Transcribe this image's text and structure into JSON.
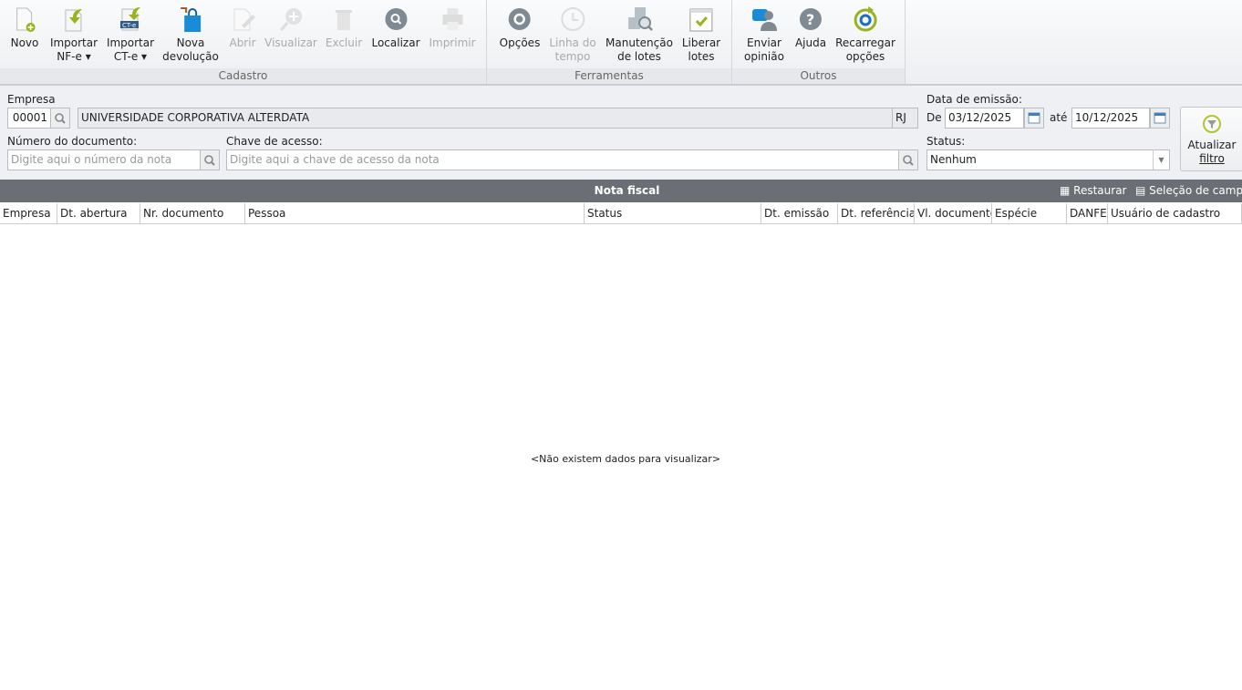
{
  "ribbon": {
    "groups": [
      {
        "label": "Cadastro"
      },
      {
        "label": "Ferramentas"
      },
      {
        "label": "Outros"
      }
    ],
    "buttons": [
      {
        "l1": "Novo",
        "l2": "",
        "icon": "new-document-icon",
        "enabled": true
      },
      {
        "l1": "Importar",
        "l2": "NF-e ▾",
        "icon": "import-nfe-icon",
        "enabled": true
      },
      {
        "l1": "Importar",
        "l2": "CT-e ▾",
        "icon": "import-cte-icon",
        "enabled": true
      },
      {
        "l1": "Nova",
        "l2": "devolução",
        "icon": "shopping-bag-return-icon",
        "enabled": true
      },
      {
        "l1": "Abrir",
        "l2": "",
        "icon": "edit-document-icon",
        "enabled": false
      },
      {
        "l1": "Visualizar",
        "l2": "",
        "icon": "zoom-in-icon",
        "enabled": false
      },
      {
        "l1": "Excluir",
        "l2": "",
        "icon": "trash-icon",
        "enabled": false
      },
      {
        "l1": "Localizar",
        "l2": "",
        "icon": "search-icon",
        "enabled": true
      },
      {
        "l1": "Imprimir",
        "l2": "",
        "icon": "printer-icon",
        "enabled": false
      },
      {
        "l1": "Opções",
        "l2": "",
        "icon": "gear-icon",
        "enabled": true
      },
      {
        "l1": "Linha do",
        "l2": "tempo",
        "icon": "clock-icon",
        "enabled": false
      },
      {
        "l1": "Manutenção",
        "l2": "de lotes",
        "icon": "boxes-search-icon",
        "enabled": true
      },
      {
        "l1": "Liberar",
        "l2": "lotes",
        "icon": "checkmark-calendar-icon",
        "enabled": true
      },
      {
        "l1": "Enviar",
        "l2": "opinião",
        "icon": "feedback-icon",
        "enabled": true
      },
      {
        "l1": "Ajuda",
        "l2": "",
        "icon": "help-icon",
        "enabled": true
      },
      {
        "l1": "Recarregar",
        "l2": "opções",
        "icon": "reload-settings-icon",
        "enabled": true
      }
    ]
  },
  "filters": {
    "empresa_label": "Empresa",
    "empresa_code": "00001",
    "empresa_name": "UNIVERSIDADE CORPORATIVA ALTERDATA",
    "uf": "RJ",
    "data_label": "Data de emissão:",
    "de_label": "De",
    "de_value": "03/12/2025",
    "ate_label": "até",
    "ate_value": "10/12/2025",
    "numero_label": "Número do documento:",
    "numero_placeholder": "Digite aqui o número da nota",
    "chave_label": "Chave de acesso:",
    "chave_placeholder": "Digite aqui a chave de acesso da nota",
    "status_label": "Status:",
    "status_value": "Nenhum",
    "atualizar_l1": "Atualizar",
    "atualizar_l2": "filtro"
  },
  "grid": {
    "title": "Nota fiscal",
    "restaurar": "Restaurar",
    "selecao": "Seleção de campos",
    "columns": [
      "Empresa",
      "Dt. abertura",
      "Nr. documento",
      "Pessoa",
      "Status",
      "Dt. emissão",
      "Dt. referência",
      "Vl. documento",
      "Espécie",
      "DANFE",
      "Usuário de cadastro"
    ],
    "empty": "<Não existem dados para visualizar>"
  },
  "colors": {
    "accent_green": "#9ab21c",
    "blue": "#1a8bd6",
    "gray_icon": "#8a9299",
    "header_bar": "#6b6e74"
  }
}
